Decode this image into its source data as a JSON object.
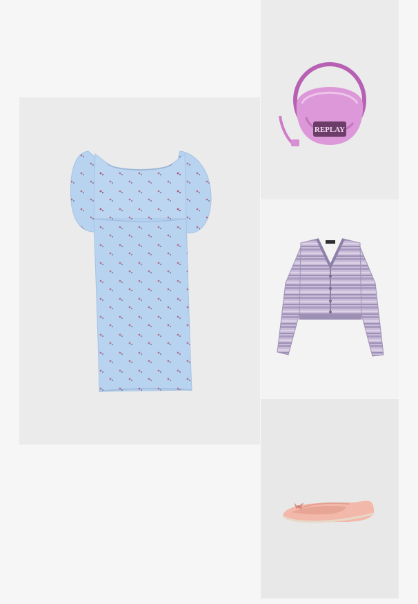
{
  "outfit": {
    "items": [
      {
        "name": "dress",
        "color": "#b7d3f0"
      },
      {
        "name": "handbag",
        "color": "#d98ed6",
        "logo_text": "REPLAY"
      },
      {
        "name": "cardigan",
        "color": "#b9aecd"
      },
      {
        "name": "ballet-flats",
        "color": "#f2b8aa"
      }
    ]
  }
}
